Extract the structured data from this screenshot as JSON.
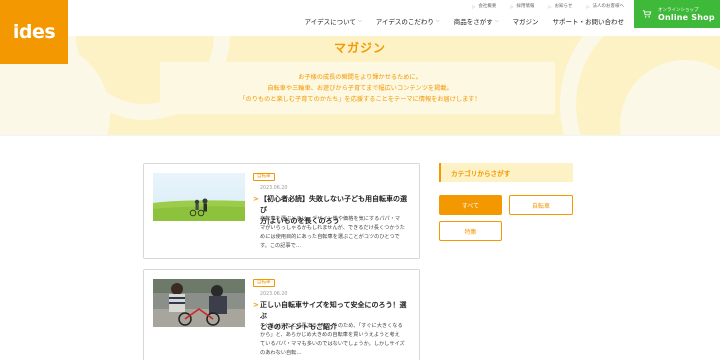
{
  "brand": {
    "logo_text": "ides",
    "accent": "#f39800",
    "shop_green": "#3fb939"
  },
  "util_links": [
    "会社概要",
    "採用情報",
    "お知らせ",
    "法人のお客様へ"
  ],
  "nav": [
    {
      "label": "アイデスについて"
    },
    {
      "label": "アイデスのこだわり"
    },
    {
      "label": "商品をさがす"
    },
    {
      "label": "マガジン"
    },
    {
      "label": "サポート・お問い合わせ"
    }
  ],
  "shop": {
    "sub": "オンラインショップ",
    "main": "Online Shop",
    "icon": "cart-icon"
  },
  "hero": {
    "title": "マガジン",
    "intro": [
      "お子様の成長の瞬間をより輝かせるために。",
      "自転車や三輪車、お遊びから子育てまで幅広いコンテンツを掲載。",
      "「のりものと楽しむ子育てのかたち」を応援することをテーマに情報をお届けします！"
    ]
  },
  "articles": [
    {
      "tag": "自転車",
      "date": "2023.06.20",
      "title_lines": [
        "【初心者必読】失敗しない子ども用自転車の選び",
        "方|よいものを長くのろう"
      ],
      "excerpt_lines": [
        "自転車を選ぶときは、デザイン性や価格を気にするパパ・マ",
        "マがいらっしゃるかもしれませんが、できるだけ長くつかうた",
        "めには使用目的にあった自転車を選ぶことがコツのひとつで",
        "す。この記事で…"
      ]
    },
    {
      "tag": "自転車",
      "date": "2023.06.20",
      "title_lines": [
        "正しい自転車サイズを知って安全にのろう！選ぶ",
        "ときのポイントもご紹介"
      ],
      "excerpt_lines": [
        "子どもはすぐに成長するもの。そのため、「すぐに大きくなる",
        "から」と、あらかじめ大きめの自転車を買いうえようと考え",
        "ているパパ・ママも多いのではないでしょうか。しかしサイズ",
        "のあわない自転…"
      ]
    }
  ],
  "categories": {
    "heading": "カテゴリからさがす",
    "items": [
      {
        "label": "すべて",
        "active": true
      },
      {
        "label": "自転車",
        "active": false
      },
      {
        "label": "特集",
        "active": false
      }
    ]
  }
}
